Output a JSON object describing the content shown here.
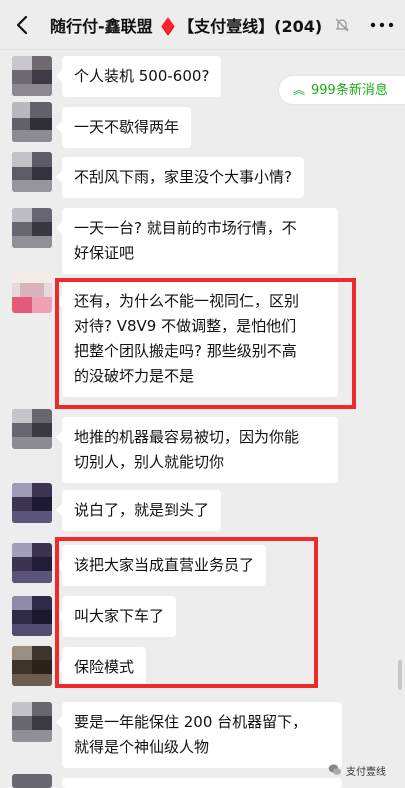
{
  "header": {
    "title": "随行付-鑫联盟 ♦️【支付壹线】(204)"
  },
  "new_messages": {
    "label": "999条新消息"
  },
  "messages": [
    {
      "text": "个人装机 500-600?"
    },
    {
      "text": "一天不歇得两年"
    },
    {
      "text": "不刮风下雨，家里没个大事小情?"
    },
    {
      "text_lines": [
        "一天一台? 就目前的市场行情，不",
        "好保证吧"
      ]
    },
    {
      "text_lines": [
        "还有，为什么不能一视同仁，区别",
        "对待? V8V9 不做调整，是怕他们",
        "把整个团队搬走吗? 那些级别不高",
        "的没破坏力是不是"
      ]
    },
    {
      "text_lines": [
        "地推的机器最容易被切，因为你能",
        "切别人，别人就能切你"
      ]
    },
    {
      "text": "说白了，就是到头了"
    },
    {
      "text": "该把大家当成直营业务员了"
    },
    {
      "text": "叫大家下车了"
    },
    {
      "text": "保险模式"
    },
    {
      "text_lines": [
        "要是一年能保住 200 台机器留下，",
        "就得是个神仙级人物"
      ]
    }
  ],
  "watermark": {
    "label": "支付壹线"
  },
  "colors": {
    "background": "#ededed",
    "bubble": "#ffffff",
    "highlight_box": "#ee2b2b",
    "new_message_text": "#1aad19"
  },
  "icons": {
    "back": "back-arrow-icon",
    "mute": "mute-bell-icon",
    "more": "more-dots-icon",
    "new_messages": "double-chevron-up-icon",
    "watermark": "wechat-logo-icon"
  }
}
